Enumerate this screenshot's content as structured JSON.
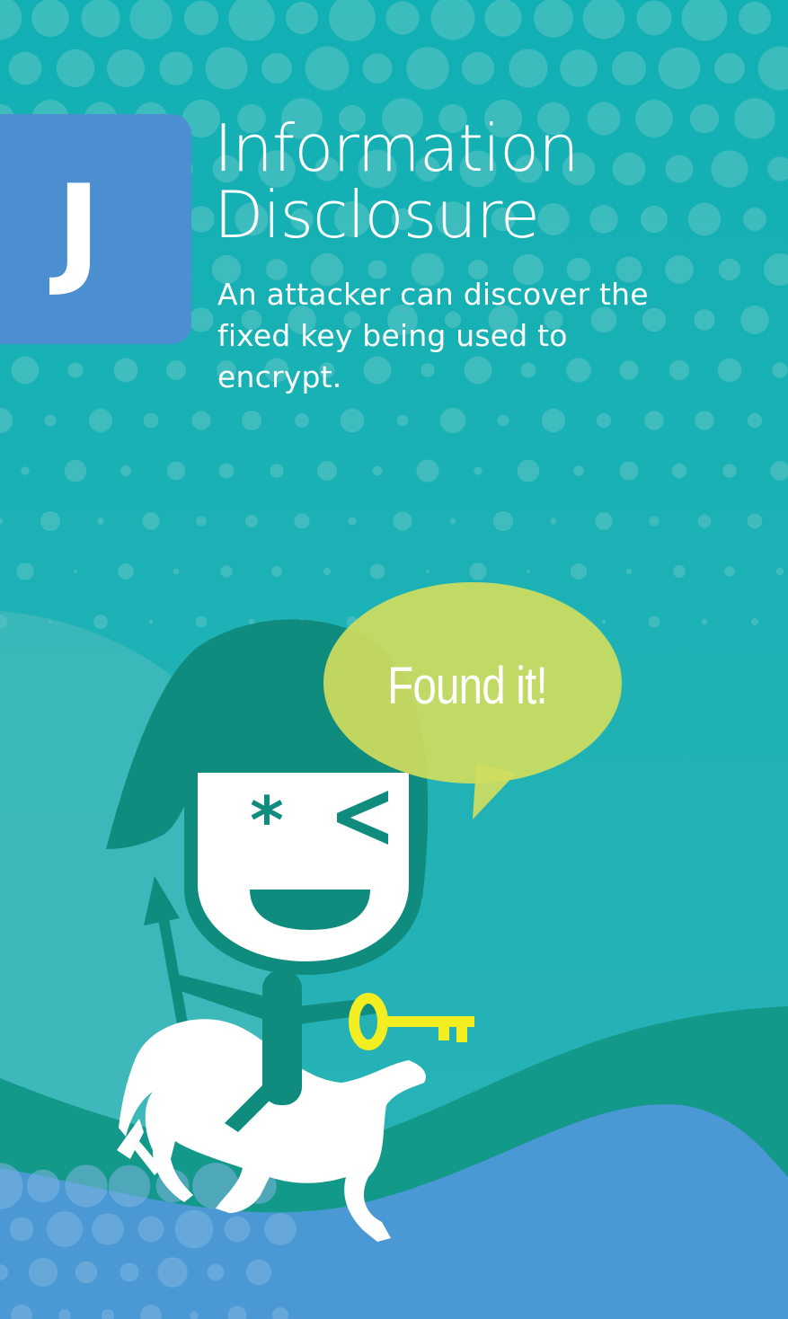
{
  "card": {
    "letter": "J",
    "title_line1": "Information",
    "title_line2": "Disclosure",
    "description": "An attacker can discover the fixed key being used to encrypt.",
    "speech": "Found it!"
  },
  "colors": {
    "background": "#2ab3b6",
    "badge": "#4b8fd0",
    "hill_green": "#13998a",
    "hill_blue": "#4a98d4",
    "character": "#108c7f",
    "bubble": "#cfdc5e",
    "key": "#f2ee22"
  },
  "icons": [
    "letter-badge",
    "speech-bubble",
    "knight-character",
    "key-icon",
    "horse-icon",
    "spear-icon"
  ]
}
